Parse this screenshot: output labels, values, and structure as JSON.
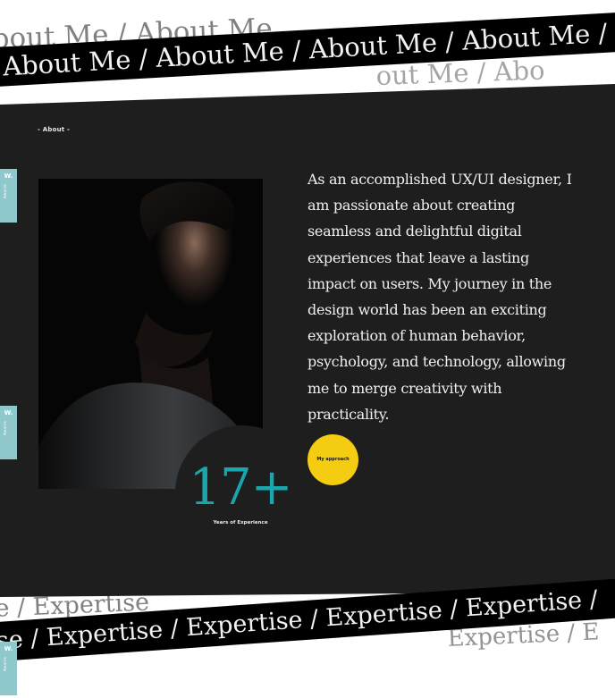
{
  "top_band": {
    "ghost_text": "bout Me  /  About Me",
    "ghost_right_text": "out Me  /  Abo",
    "text": "About Me  /  About Me  /  About Me  /  About Me  /  Ab"
  },
  "bottom_band": {
    "ghost_text": "se  /  Expertise",
    "ghost_right_text": "Expertise  /  E",
    "text": "ise  /  Expertise  /  Expertise  /  Expertise  /  Expertise  /"
  },
  "section_label": "- About -",
  "side_tabs": [
    {
      "mark": "W.",
      "label": "Awards"
    },
    {
      "mark": "W.",
      "label": "Awards"
    },
    {
      "mark": "W.",
      "label": "Awards"
    }
  ],
  "bio": {
    "lines": [
      "As an accomplished UX/UI designer, I",
      "am passionate about creating",
      "seamless and delightful digital",
      "experiences that leave a lasting",
      "impact on users. My journey in the",
      "design world has been an exciting",
      "exploration of human behavior,",
      "psychology, and technology, allowing",
      "me to merge creativity with",
      "practicality."
    ]
  },
  "approach_button": {
    "label": "My approach"
  },
  "experience": {
    "number": "17+",
    "label": "Years of Experience"
  },
  "colors": {
    "panel": "#1e1e1e",
    "accent_teal": "#1aa6ad",
    "accent_yellow": "#f4cc11",
    "side_tab": "#8ec8cc"
  }
}
